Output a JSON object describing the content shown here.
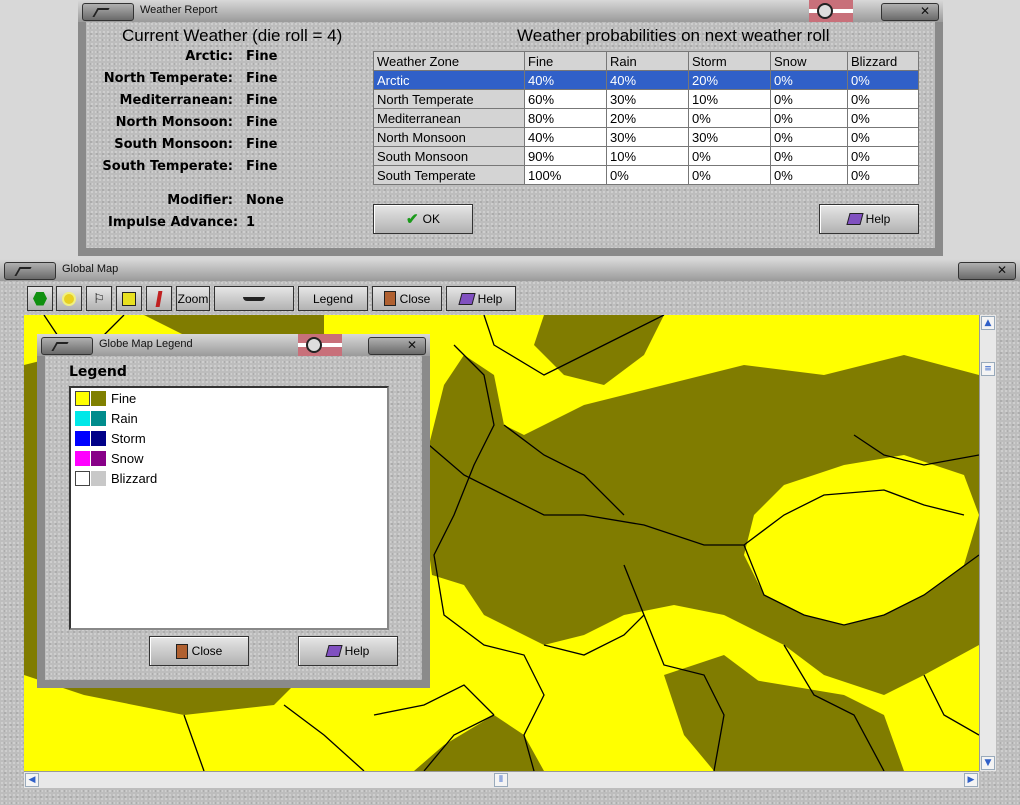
{
  "weather_report": {
    "title": "Weather Report",
    "current_heading": "Current Weather (die roll = 4)",
    "prob_heading": "Weather probabilities on next weather roll",
    "zones": [
      {
        "label": "Arctic:",
        "value": "Fine"
      },
      {
        "label": "North Temperate:",
        "value": "Fine"
      },
      {
        "label": "Mediterranean:",
        "value": "Fine"
      },
      {
        "label": "North Monsoon:",
        "value": "Fine"
      },
      {
        "label": "South Monsoon:",
        "value": "Fine"
      },
      {
        "label": "South Temperate:",
        "value": "Fine"
      }
    ],
    "modifier_label": "Modifier:",
    "modifier_value": "None",
    "impulse_label": "Impulse Advance:",
    "impulse_value": "1",
    "table": {
      "headers": [
        "Weather Zone",
        "Fine",
        "Rain",
        "Storm",
        "Snow",
        "Blizzard"
      ],
      "rows": [
        [
          "Arctic",
          "40%",
          "40%",
          "20%",
          "0%",
          "0%"
        ],
        [
          "North Temperate",
          "60%",
          "30%",
          "10%",
          "0%",
          "0%"
        ],
        [
          "Mediterranean",
          "80%",
          "20%",
          "0%",
          "0%",
          "0%"
        ],
        [
          "North Monsoon",
          "40%",
          "30%",
          "30%",
          "0%",
          "0%"
        ],
        [
          "South Monsoon",
          "90%",
          "10%",
          "0%",
          "0%",
          "0%"
        ],
        [
          "South Temperate",
          "100%",
          "0%",
          "0%",
          "0%",
          "0%"
        ]
      ],
      "selected_row": 0
    },
    "ok_label": "OK",
    "help_label": "Help"
  },
  "global_map": {
    "title": "Global Map",
    "toolbar": {
      "zoom_label": "Zoom",
      "legend_label": "Legend",
      "close_label": "Close",
      "help_label": "Help"
    },
    "colors": {
      "land_fine": "#ffff00",
      "land_dark": "#807c00",
      "border": "#000000"
    }
  },
  "legend_window": {
    "title": "Globe Map Legend",
    "heading": "Legend",
    "items": [
      {
        "label": "Fine",
        "light": "#ffff00",
        "dark": "#808000"
      },
      {
        "label": "Rain",
        "light": "#00e8e8",
        "dark": "#008c8c"
      },
      {
        "label": "Storm",
        "light": "#0000ff",
        "dark": "#000088"
      },
      {
        "label": "Snow",
        "light": "#ff00ff",
        "dark": "#880088"
      },
      {
        "label": "Blizzard",
        "light": "#ffffff",
        "dark": "#c8c8c8"
      }
    ],
    "close_label": "Close",
    "help_label": "Help"
  }
}
